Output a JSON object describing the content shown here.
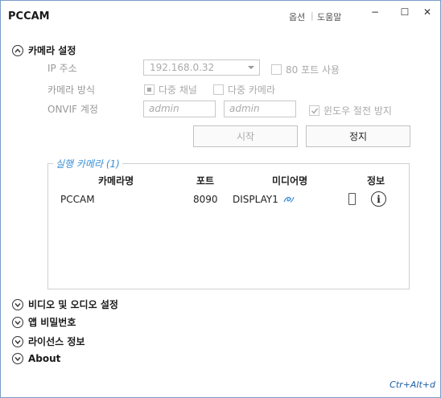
{
  "app": {
    "title": "PCCAM",
    "menu": {
      "options": "옵션",
      "help": "도움말"
    },
    "window_controls": {
      "minimize": "−",
      "maximize": "☐",
      "close": "✕"
    }
  },
  "camera_settings": {
    "header": "카메라 설정",
    "ip": {
      "label": "IP 주소",
      "value": "192.168.0.32",
      "port80_label": "80 포트 사용",
      "port80_checked": false
    },
    "mode": {
      "label": "카메라 방식",
      "multi_channel_label": "다중 채널",
      "multi_channel_checked": true,
      "multi_camera_label": "다중 카메라",
      "multi_camera_checked": false
    },
    "onvif": {
      "label": "ONVIF 계정",
      "username_placeholder": "admin",
      "password_placeholder": "admin",
      "prevent_sleep_label": "윈도우 절전 방지",
      "prevent_sleep_checked": true
    },
    "buttons": {
      "start": "시작",
      "stop": "정지"
    }
  },
  "running_cameras": {
    "title": "실행 카메라 (1)",
    "columns": {
      "name": "카메라명",
      "port": "포트",
      "media": "미디어명",
      "info": "정보"
    },
    "rows": [
      {
        "name": "PCCAM",
        "port": "8090",
        "media": "DISPLAY1"
      }
    ]
  },
  "sections": {
    "video_audio": "비디오 및 오디오 설정",
    "app_password": "앱 비밀번호",
    "license": "라이선스 정보",
    "about": "About"
  },
  "shortcut": "Ctr+Alt+d",
  "colors": {
    "accent": "#3a8fd6",
    "shortcut": "#1f5fa8",
    "border": "#7a9cc6"
  }
}
